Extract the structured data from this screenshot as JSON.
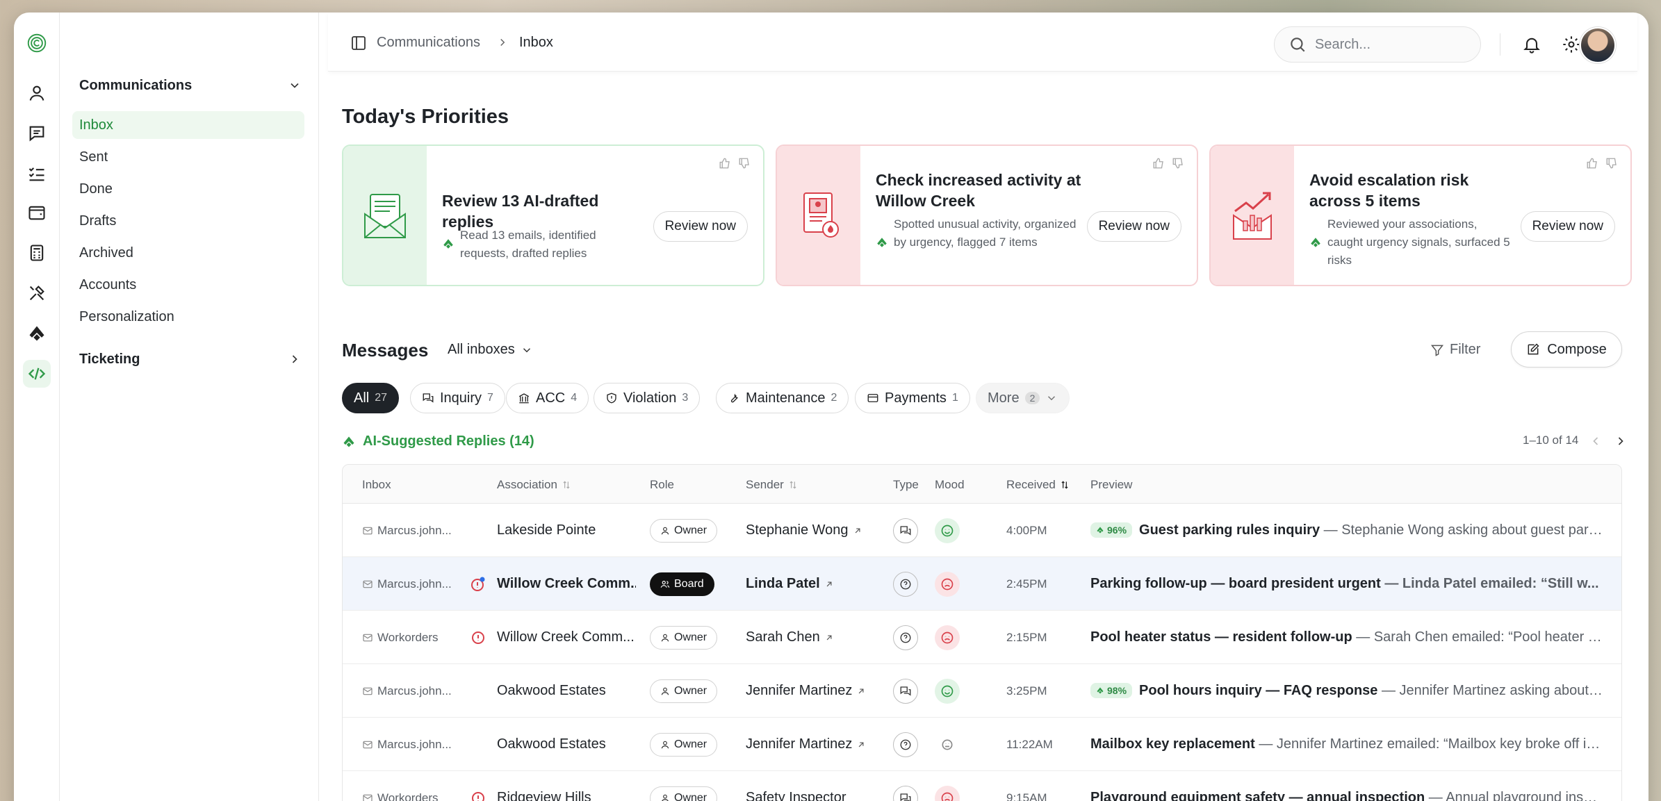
{
  "breadcrumb": {
    "section": "Communications",
    "current": "Inbox"
  },
  "search": {
    "placeholder": "Search..."
  },
  "subnav": {
    "group1": "Communications",
    "items": [
      "Inbox",
      "Sent",
      "Done",
      "Drafts",
      "Archived",
      "Accounts",
      "Personalization"
    ],
    "group2": "Ticketing"
  },
  "priorities": {
    "title": "Today's Priorities",
    "cards": [
      {
        "title": "Review 13 AI-drafted replies",
        "desc": "Read 13 emails, identified requests, drafted replies",
        "button": "Review now"
      },
      {
        "title": "Check increased activity at Willow Creek",
        "desc": "Spotted unusual activity, organized by urgency, flagged 7 items",
        "button": "Review now"
      },
      {
        "title": "Avoid escalation risk across 5 items",
        "desc": "Reviewed your associations, caught urgency signals, surfaced 5 risks",
        "button": "Review now"
      }
    ]
  },
  "messages": {
    "title": "Messages",
    "inbox_filter": "All inboxes",
    "filter_label": "Filter",
    "compose_label": "Compose",
    "chips": [
      {
        "label": "All",
        "count": "27"
      },
      {
        "label": "Inquiry",
        "count": "7"
      },
      {
        "label": "ACC",
        "count": "4"
      },
      {
        "label": "Violation",
        "count": "3"
      },
      {
        "label": "Maintenance",
        "count": "2"
      },
      {
        "label": "Payments",
        "count": "1"
      },
      {
        "label": "More",
        "count": "2"
      }
    ],
    "ai_label": "AI-Suggested Replies (14)",
    "pager": "1–10 of 14",
    "columns": [
      "Inbox",
      "Association",
      "Role",
      "Sender",
      "Type",
      "Mood",
      "Received",
      "Preview"
    ],
    "rows": [
      {
        "inbox": "Marcus.john...",
        "association": "Lakeside Pointe",
        "role": "Owner",
        "sender": "Stephanie Wong",
        "received": "4:00PM",
        "confidence": "96%",
        "subject": "Guest parking rules inquiry",
        "snippet": " — Stephanie Wong asking about guest parki..."
      },
      {
        "inbox": "Marcus.john...",
        "association": "Willow Creek Comm...",
        "role": "Board",
        "sender": "Linda Patel",
        "received": "2:45PM",
        "subject": "Parking follow-up — board president urgent",
        "snippet": " — Linda Patel emailed: “Still w..."
      },
      {
        "inbox": "Workorders",
        "association": "Willow Creek Comm...",
        "role": "Owner",
        "sender": "Sarah Chen",
        "received": "2:15PM",
        "subject": "Pool heater status — resident follow-up",
        "snippet": " — Sarah Chen emailed: “Pool heater sti..."
      },
      {
        "inbox": "Marcus.john...",
        "association": "Oakwood Estates",
        "role": "Owner",
        "sender": "Jennifer Martinez",
        "received": "3:25PM",
        "confidence": "98%",
        "subject": "Pool hours inquiry — FAQ response",
        "snippet": " — Jennifer Martinez asking about p..."
      },
      {
        "inbox": "Marcus.john...",
        "association": "Oakwood Estates",
        "role": "Owner",
        "sender": "Jennifer Martinez",
        "received": "11:22AM",
        "subject": "Mailbox key replacement",
        "snippet": " — Jennifer Martinez emailed: “Mailbox key broke off in..."
      },
      {
        "inbox": "Workorders",
        "association": "Ridgeview Hills",
        "role": "Owner",
        "sender": "Safety Inspector",
        "received": "9:15AM",
        "subject": "Playground equipment safety — annual inspection",
        "snippet": " — Annual playground inspe..."
      }
    ]
  },
  "colors": {
    "accent_green": "#2f9a48",
    "alert_red": "#d9414b",
    "board_black": "#111111"
  }
}
